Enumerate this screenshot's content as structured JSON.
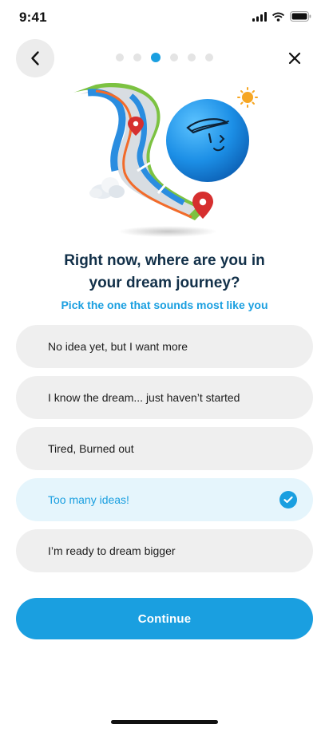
{
  "status": {
    "time": "9:41"
  },
  "progress": {
    "total_steps": 6,
    "current_step": 3
  },
  "heading": {
    "line1": "Right now, where are you in",
    "line2": "your dream journey?",
    "subtitle": "Pick the one that sounds most like you"
  },
  "options": [
    {
      "label": "No idea yet, but I want more",
      "selected": false
    },
    {
      "label": "I know the dream... just haven’t started",
      "selected": false
    },
    {
      "label": "Tired, Burned out",
      "selected": false
    },
    {
      "label": "Too many ideas!",
      "selected": true
    },
    {
      "label": "I’m ready to dream bigger",
      "selected": false
    }
  ],
  "continue_label": "Continue",
  "colors": {
    "accent": "#1a9fe0",
    "option_bg": "#efefef",
    "selected_bg": "#e5f5fc",
    "heading": "#123049"
  },
  "icons": {
    "back": "chevron-left-icon",
    "close": "close-icon",
    "check": "check-circle-icon"
  }
}
